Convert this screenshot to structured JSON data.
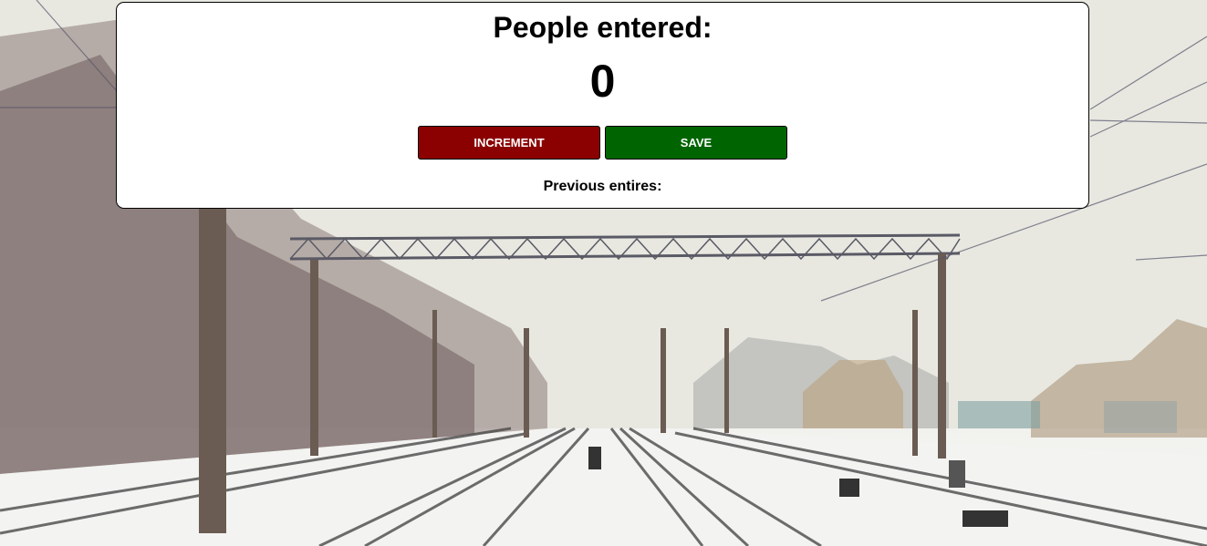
{
  "counter": {
    "heading": "People entered:",
    "value": "0",
    "increment_label": "INCREMENT",
    "save_label": "SAVE",
    "previous_label": "Previous entires:"
  },
  "colors": {
    "increment_button": "#8b0000",
    "save_button": "#006400",
    "card_background": "#ffffff"
  },
  "background": {
    "scene": "snowy-railway-photo"
  }
}
